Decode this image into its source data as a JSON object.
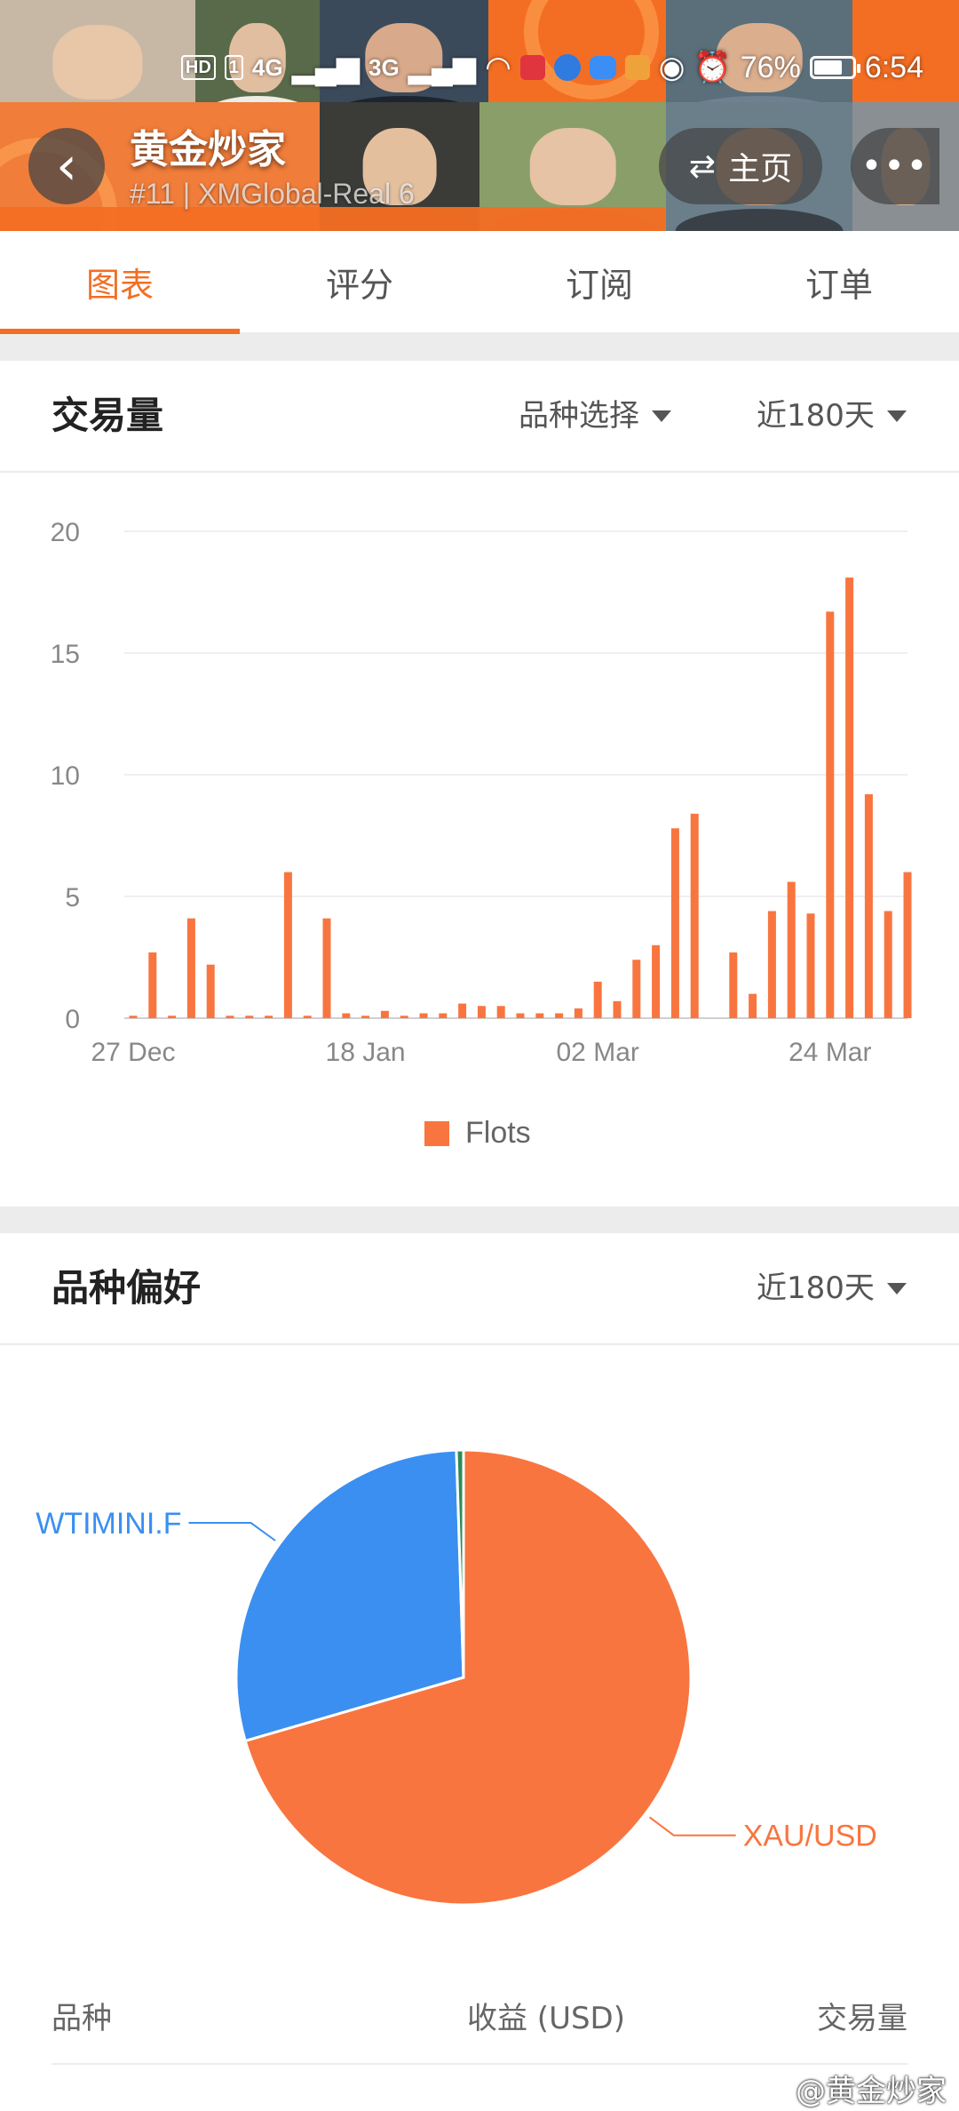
{
  "status_bar": {
    "hd_badge": "HD",
    "sim_badge": "1",
    "net1": "4G",
    "net2": "3G",
    "battery_pct": "76%",
    "time": "6:54",
    "battery_fraction": 0.76
  },
  "header": {
    "back_icon": "chevron-left-icon",
    "trader_name": "黄金炒家",
    "trader_sub": "#11 | XMGlobal-Real 6",
    "home_label": "主页",
    "home_icon": "swap-arrows-icon",
    "more_icon": "more-dots-icon"
  },
  "tabs": [
    {
      "label": "图表",
      "active": true
    },
    {
      "label": "评分",
      "active": false
    },
    {
      "label": "订阅",
      "active": false
    },
    {
      "label": "订单",
      "active": false
    }
  ],
  "volume_section": {
    "title": "交易量",
    "filter_label": "品种选择",
    "period_label": "近180天"
  },
  "preference_section": {
    "title": "品种偏好",
    "period_label": "近180天"
  },
  "colors": {
    "accent": "#f36e23",
    "bar": "#f9753f",
    "pie_blue": "#3b8ff0",
    "pie_green": "#2e8b57"
  },
  "chart_data": [
    {
      "type": "bar",
      "legend": [
        "Flots"
      ],
      "x_tick_labels": [
        "27 Dec",
        "18 Jan",
        "02 Mar",
        "24 Mar"
      ],
      "x_tick_indices": [
        0,
        12,
        24,
        36
      ],
      "y_ticks": [
        0,
        5,
        10,
        15,
        20
      ],
      "ylim": [
        0,
        20
      ],
      "grid": true,
      "legend_position": "bottom",
      "series": [
        {
          "name": "Flots",
          "values": [
            0.1,
            2.7,
            0.1,
            4.1,
            2.2,
            0.1,
            0.1,
            0.1,
            6.0,
            0.1,
            4.1,
            0.2,
            0.1,
            0.3,
            0.1,
            0.2,
            0.2,
            0.6,
            0.5,
            0.5,
            0.2,
            0.2,
            0.2,
            0.4,
            1.5,
            0.7,
            2.4,
            3.0,
            7.8,
            8.4,
            0,
            2.7,
            1.0,
            4.4,
            5.6,
            4.3,
            16.7,
            18.1,
            9.2,
            4.4,
            6.0
          ]
        }
      ]
    },
    {
      "type": "pie",
      "slices": [
        {
          "label": "XAU/USD",
          "value": 70.5,
          "color": "#f9753f"
        },
        {
          "label": "WTIMINI.F",
          "value": 29.0,
          "color": "#3b8ff0"
        },
        {
          "label": "",
          "value": 0.5,
          "color": "#2e8b57"
        }
      ]
    }
  ],
  "table": {
    "col_symbol": "品种",
    "col_profit": "收益 (USD)",
    "col_volume": "交易量"
  },
  "watermark": "@黄金炒家"
}
